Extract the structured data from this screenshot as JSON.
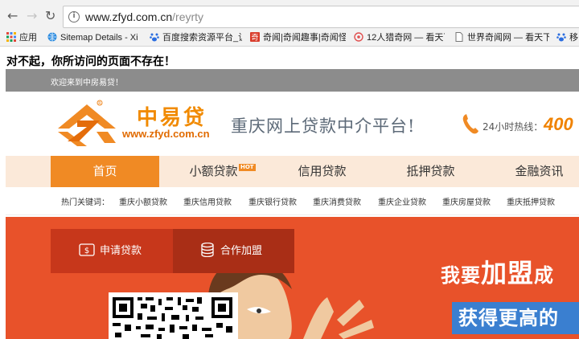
{
  "browser": {
    "back": "←",
    "forward": "→",
    "reload": "↻",
    "url_host": "www.zfyd.com.cn",
    "url_path": "/reyrty",
    "info_icon": "info-icon",
    "bookmarks": [
      {
        "label": "应用",
        "icon": "apps-grid-icon",
        "color": "#4285f4"
      },
      {
        "label": "Sitemap Details - Xi",
        "icon": "globe-icon",
        "color": "#2a8be0"
      },
      {
        "label": "百度搜索资源平台_让",
        "icon": "baidu-paw-icon",
        "color": "#2a6de0"
      },
      {
        "label": "奇闻|奇闻趣事|奇闻怪",
        "icon": "site-icon",
        "color": "#d93c2b"
      },
      {
        "label": "12人猎奇网 — 看天下",
        "icon": "site-icon",
        "color": "#e05050"
      },
      {
        "label": "世界奇闻网 — 看天下",
        "icon": "page-icon",
        "color": "#777777"
      },
      {
        "label": "移",
        "icon": "baidu-paw-icon",
        "color": "#2a6de0"
      }
    ]
  },
  "page": {
    "error_message": "对不起，你所访问的页面不存在！",
    "welcome": "欢迎来到中房易贷！",
    "logo_name": "中易贷",
    "logo_url": "www.zfyd.com.cn",
    "slogan": "重庆网上贷款中介平台!",
    "hotline_label": "24小时热线：",
    "hotline_number": "400",
    "menu": [
      {
        "label": "首页",
        "active": true
      },
      {
        "label": "小额贷款",
        "badge": "HOT"
      },
      {
        "label": "信用贷款"
      },
      {
        "label": "抵押贷款"
      },
      {
        "label": "金融资讯"
      }
    ],
    "keywords_label": "热门关键词：",
    "keywords": [
      "重庆小额贷款",
      "重庆信用贷款",
      "重庆银行贷款",
      "重庆消费贷款",
      "重庆企业贷款",
      "重庆房屋贷款",
      "重庆抵押贷款"
    ],
    "banner_tabs": [
      {
        "label": "申请贷款",
        "icon": "dollar-doc-icon"
      },
      {
        "label": "合作加盟",
        "icon": "database-icon"
      }
    ],
    "ad_line1_a": "我要",
    "ad_line1_b": "加盟",
    "ad_line1_c": "成",
    "ad_line2": "获得更高的"
  },
  "colors": {
    "accent": "#f08a24",
    "banner": "#e8522a",
    "banner_tab_bg": "#c7371b",
    "menubar": "#fbe9d9",
    "welcome_bar": "#8c8c8c",
    "ad_blue": "#3a7fd0"
  }
}
